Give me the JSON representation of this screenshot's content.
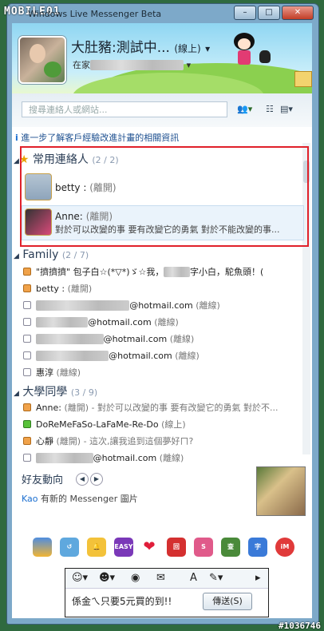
{
  "watermark": "MOBILE01",
  "code": "#1036746",
  "window": {
    "title": "Windows Live Messenger Beta"
  },
  "me": {
    "name": "大肚豬:測試中...",
    "status": "(線上)",
    "mood_prefix": "在家"
  },
  "search": {
    "placeholder": "搜尋連絡人或網站..."
  },
  "info": "進一步了解客戶經驗改進計畫的相關資訊",
  "favorites": {
    "title": "常用連絡人",
    "count": "(2 / 2)",
    "contacts": [
      {
        "name": "betty :",
        "status": "(離開)",
        "message": ""
      },
      {
        "name": "Anne:",
        "status": "(離開)",
        "message": "對於可以改變的事 要有改變它的勇氣  對於不能改變的事..."
      }
    ]
  },
  "family": {
    "title": "Family",
    "count": "(2 / 7)",
    "rows": [
      {
        "text": "\"擠擠擠\" 包子白☆(*▽*)ゞ☆我，",
        "status": "",
        "tail": "字小白，駝魚頭！("
      },
      {
        "text": "betty :",
        "status": "(離開)"
      },
      {
        "text": "@hotmail.com",
        "status": "(離線)"
      },
      {
        "text": "@hotmail.com",
        "status": "(離線)"
      },
      {
        "text": "@hotmail.com",
        "status": "(離線)"
      },
      {
        "text": "@hotmail.com",
        "status": "(離線)"
      },
      {
        "text": "惠淳",
        "status": "(離線)"
      }
    ]
  },
  "college": {
    "title": "大學同學",
    "count": "(3 / 9)",
    "rows": [
      {
        "text": "Anne:",
        "status": "(離開)",
        "tail": "- 對於可以改變的事 要有改變它的勇氣  對於不..."
      },
      {
        "text": "DoReMeFaSo-LaFaMe-Re-Do",
        "status": "(線上)",
        "tail": ""
      },
      {
        "text": "心靜",
        "status": "(離開)",
        "tail": "- 這次,讓我追到這個夢好ㄇ?"
      },
      {
        "text": "@hotmail.com",
        "status": "(離線)",
        "tail": ""
      }
    ]
  },
  "feed": {
    "title": "好友動向",
    "name": "Kao",
    "text": " 有新的 Messenger 圖片"
  },
  "compose": {
    "text": "係金ㄟ只要5元買的到!!",
    "send": "傳送(S)"
  }
}
